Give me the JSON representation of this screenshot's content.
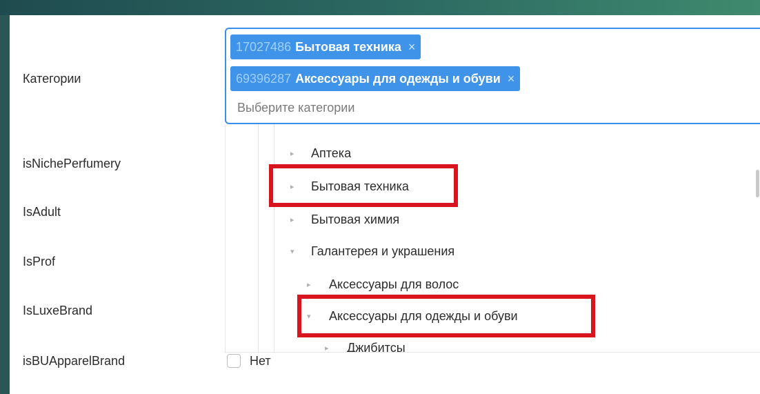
{
  "form": {
    "fields": [
      {
        "label": "Категории"
      },
      {
        "label": "isNichePerfumery"
      },
      {
        "label": "IsAdult"
      },
      {
        "label": "IsProf"
      },
      {
        "label": "IsLuxeBrand"
      },
      {
        "label": "isBUApparelBrand"
      }
    ],
    "categories_select": {
      "tags": [
        {
          "id": "17027486",
          "name": "Бытовая техника",
          "remove": "×"
        },
        {
          "id": "69396287",
          "name": "Аксессуары для одежды и обуви",
          "remove": "×"
        }
      ],
      "placeholder": "Выберите категории"
    },
    "brand_checkbox": {
      "label": "Нет",
      "checked": false
    }
  },
  "dropdown": {
    "items": [
      {
        "label": "Аптека",
        "icon": "caret-right-icon"
      },
      {
        "label": "Бытовая техника",
        "icon": "caret-right-icon"
      },
      {
        "label": "Бытовая химия",
        "icon": "caret-right-icon"
      },
      {
        "label": "Галантерея и украшения",
        "icon": "caret-down-icon"
      },
      {
        "label": "Аксессуары для волос",
        "icon": "caret-right-icon"
      },
      {
        "label": "Аксессуары для одежды и обуви",
        "icon": "caret-down-icon"
      },
      {
        "label": "Джибитсы",
        "icon": "caret-right-icon"
      }
    ]
  },
  "colors": {
    "accent": "#3f94ea",
    "highlight": "#d8141e",
    "frame": "#2b5656"
  }
}
